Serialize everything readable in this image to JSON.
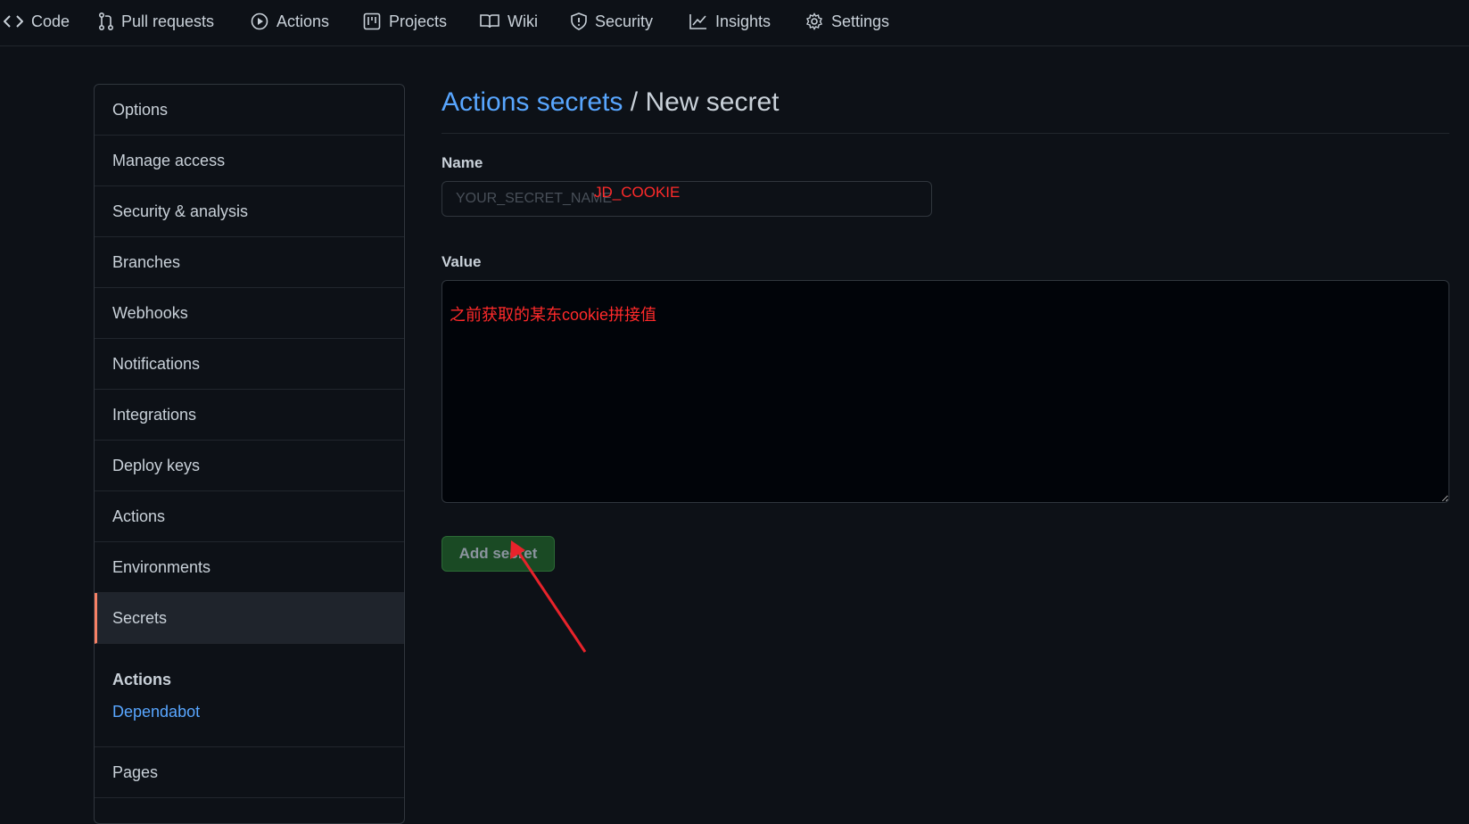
{
  "nav": {
    "items": [
      {
        "label": "Code",
        "icon": "code-icon"
      },
      {
        "label": "Pull requests",
        "icon": "git-pull-request-icon"
      },
      {
        "label": "Actions",
        "icon": "play-icon"
      },
      {
        "label": "Projects",
        "icon": "project-icon"
      },
      {
        "label": "Wiki",
        "icon": "book-icon"
      },
      {
        "label": "Security",
        "icon": "shield-icon"
      },
      {
        "label": "Insights",
        "icon": "graph-icon"
      },
      {
        "label": "Settings",
        "icon": "gear-icon"
      }
    ]
  },
  "sidebar": {
    "items": [
      {
        "label": "Options"
      },
      {
        "label": "Manage access"
      },
      {
        "label": "Security & analysis"
      },
      {
        "label": "Branches"
      },
      {
        "label": "Webhooks"
      },
      {
        "label": "Notifications"
      },
      {
        "label": "Integrations"
      },
      {
        "label": "Deploy keys"
      },
      {
        "label": "Actions"
      },
      {
        "label": "Environments"
      },
      {
        "label": "Secrets",
        "selected": true
      }
    ],
    "section_title": "Actions",
    "section_link": "Dependabot",
    "pages_label": "Pages"
  },
  "main": {
    "breadcrumb_link": "Actions secrets",
    "breadcrumb_sep": " / ",
    "breadcrumb_current": "New secret",
    "name_label": "Name",
    "name_placeholder": "YOUR_SECRET_NAME",
    "name_annotation": "JD_COOKIE",
    "value_label": "Value",
    "value_text": "之前获取的某东cookie拼接值",
    "submit_label": "Add secret"
  },
  "colors": {
    "background": "#0d1117",
    "link": "#58a6ff",
    "selected_marker": "#f78166",
    "annotation": "#ff2a2a",
    "button": "#1a4a24"
  }
}
